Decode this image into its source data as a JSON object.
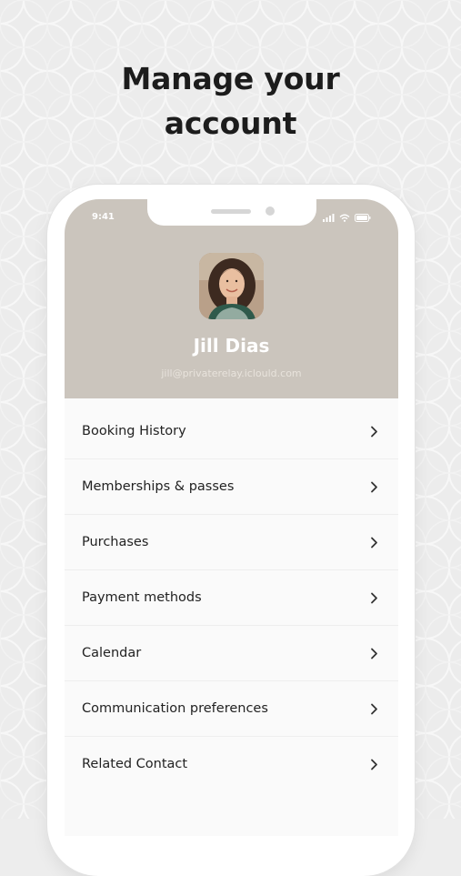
{
  "headline": {
    "line1": "Manage your",
    "line2": "account"
  },
  "status_bar": {
    "time": "9:41",
    "icons": [
      "signal-icon",
      "wifi-icon",
      "battery-icon"
    ]
  },
  "profile": {
    "avatar_icon": "profile-photo",
    "name": "Jill Dias",
    "email": "jill@privaterelay.iclould.com"
  },
  "menu": {
    "items": [
      {
        "label": "Booking History",
        "icon": "chevron-right-icon"
      },
      {
        "label": "Memberships & passes",
        "icon": "chevron-right-icon"
      },
      {
        "label": "Purchases",
        "icon": "chevron-right-icon"
      },
      {
        "label": "Payment methods",
        "icon": "chevron-right-icon"
      },
      {
        "label": "Calendar",
        "icon": "chevron-right-icon"
      },
      {
        "label": "Communication preferences",
        "icon": "chevron-right-icon"
      },
      {
        "label": "Related Contact",
        "icon": "chevron-right-icon"
      }
    ]
  },
  "colors": {
    "background": "#ededed",
    "header": "#cbc5bd",
    "text": "#222222"
  }
}
